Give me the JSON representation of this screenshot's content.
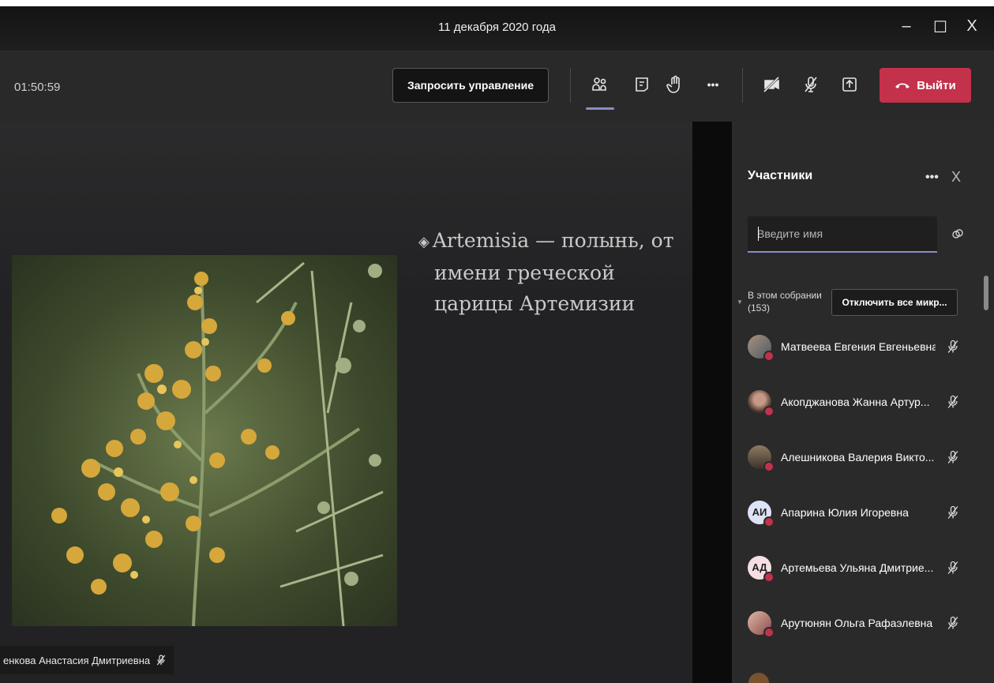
{
  "window": {
    "title": "11 декабря 2020 года",
    "controls": {
      "minimize": "–",
      "maximize": "☐",
      "close": "X"
    }
  },
  "toolbar": {
    "timer": "01:50:59",
    "request_control": "Запросить управление",
    "icons": [
      "participants-icon",
      "chat-icon",
      "raise-hand-icon",
      "more-icon",
      "camera-off-icon",
      "mic-off-icon",
      "share-screen-icon"
    ],
    "more_label": "•••",
    "leave": "Выйти"
  },
  "slide": {
    "bullet": "◈",
    "text_line1": "Artemisia — полынь, от",
    "text_line2": "имени греческой",
    "text_line3": "царицы Артемизии",
    "presenter_name": "енкова Анастасия Дмитриевна"
  },
  "panel": {
    "title": "Участники",
    "more": "•••",
    "close": "X",
    "search_placeholder": "Введите имя",
    "group_label_line1": "В этом собрании",
    "group_label_line2": "(153)",
    "mute_all": "Отключить все микр...",
    "participants": [
      {
        "name": "Матвеева Евгения Евгеньевна",
        "initials": "",
        "avatar_color": "#8a7b72"
      },
      {
        "name": "Акопджанова Жанна Артур...",
        "initials": "",
        "avatar_color": "#4a3b33"
      },
      {
        "name": "Алешникова Валерия Викто...",
        "initials": "",
        "avatar_color": "#6e5a4b"
      },
      {
        "name": "Апарина Юлия Игоревна",
        "initials": "АИ",
        "avatar_color": "#dce3f5"
      },
      {
        "name": "Артемьева Ульяна Дмитрие...",
        "initials": "АД",
        "avatar_color": "#f5dfe3"
      },
      {
        "name": "Арутюнян Ольга Рафаэлевна",
        "initials": "",
        "avatar_color": "#b57e7a"
      }
    ]
  },
  "colors": {
    "accent": "#8b8cc7",
    "leave_red": "#c4314b",
    "panel_bg": "#2a2a2a",
    "toolbar_bg": "#292929"
  }
}
